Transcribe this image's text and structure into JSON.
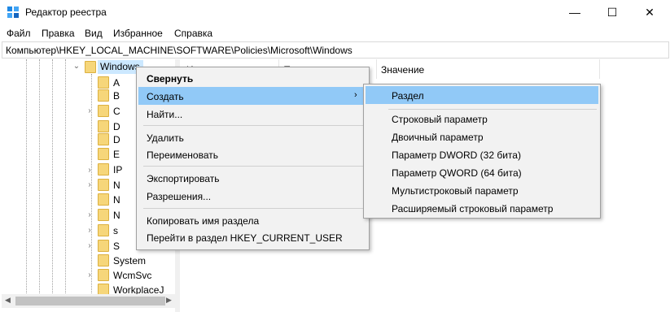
{
  "window": {
    "title": "Редактор реестра",
    "controls": {
      "minimize": "—",
      "maximize": "☐",
      "close": "✕"
    }
  },
  "menu": {
    "file": "Файл",
    "edit": "Правка",
    "view": "Вид",
    "favorites": "Избранное",
    "help": "Справка"
  },
  "address": {
    "path": "Компьютер\\HKEY_LOCAL_MACHINE\\SOFTWARE\\Policies\\Microsoft\\Windows"
  },
  "tree": {
    "selected": "Windows",
    "items": [
      "A",
      "B",
      "C",
      "D",
      "D",
      "E",
      "IP",
      "N",
      "N",
      "N",
      "s",
      "S",
      "System",
      "WcmSvc",
      "WorkplaceJ"
    ]
  },
  "list": {
    "col_name": "И",
    "col_type": "Т",
    "col_value": "Значение"
  },
  "context_menu": {
    "collapse": "Свернуть",
    "create": "Создать",
    "find": "Найти...",
    "delete": "Удалить",
    "rename": "Переименовать",
    "export": "Экспортировать",
    "permissions": "Разрешения...",
    "copy_key_name": "Копировать имя раздела",
    "goto_hkcu": "Перейти в раздел HKEY_CURRENT_USER"
  },
  "submenu": {
    "key": "Раздел",
    "string": "Строковый параметр",
    "binary": "Двоичный параметр",
    "dword": "Параметр DWORD (32 бита)",
    "qword": "Параметр QWORD (64 бита)",
    "multistring": "Мультистроковый параметр",
    "expandstring": "Расширяемый строковый параметр"
  },
  "colors": {
    "highlight": "#91c9f7",
    "selection": "#cce8ff",
    "folder": "#f6d67a",
    "menu_bg": "#f2f2f2"
  }
}
